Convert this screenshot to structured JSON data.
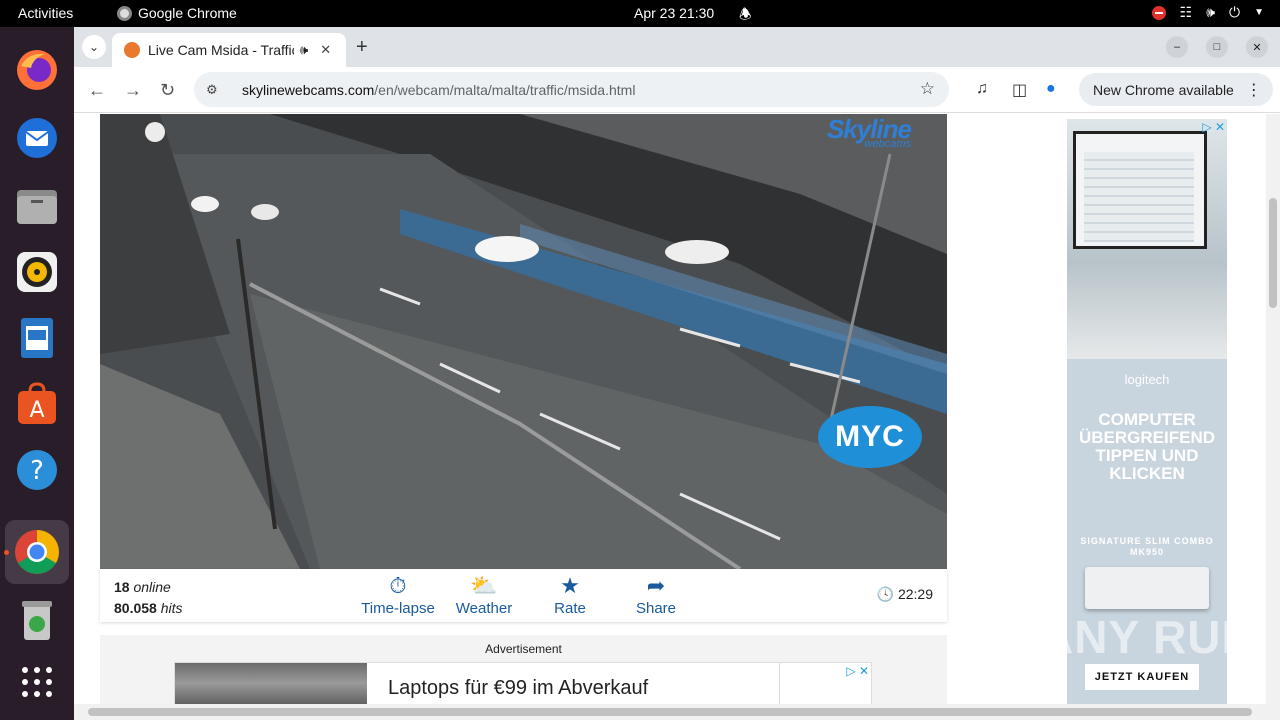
{
  "system": {
    "activities": "Activities",
    "app_name": "Google Chrome",
    "clock": "Apr 23  21:30"
  },
  "browser": {
    "tab_title": "Live Cam Msida - Traffic",
    "url_host": "skylinewebcams.com",
    "url_path": "/en/webcam/malta/malta/traffic/msida.html",
    "update_label": "New Chrome available"
  },
  "webcam": {
    "logo_text": "Skyline",
    "logo_sub": "webcams",
    "overlay_badge": "MYC",
    "online_count": "18",
    "online_label": "online",
    "hits_count": "80.058",
    "hits_label": "hits",
    "actions": [
      {
        "label": "Time-lapse",
        "icon": "timelapse-icon"
      },
      {
        "label": "Weather",
        "icon": "weather-icon"
      },
      {
        "label": "Rate",
        "icon": "star-icon"
      },
      {
        "label": "Share",
        "icon": "share-icon"
      }
    ],
    "local_time": "22:29"
  },
  "ads": {
    "label": "Advertisement",
    "banner_text": "Laptops für €99 im Abverkauf",
    "side_brand": "logitech",
    "side_headline": "COMPUTER ÜBERGREIFEND TIPPEN UND KLICKEN",
    "side_product": "SIGNATURE SLIM COMBO MK950",
    "side_cta": "JETZT KAUFEN"
  },
  "watermark": "ANY RUN",
  "colors": {
    "link_blue": "#1a5a9c",
    "dock_bg": "#2a1d2a",
    "ubuntu_orange": "#e95420"
  }
}
